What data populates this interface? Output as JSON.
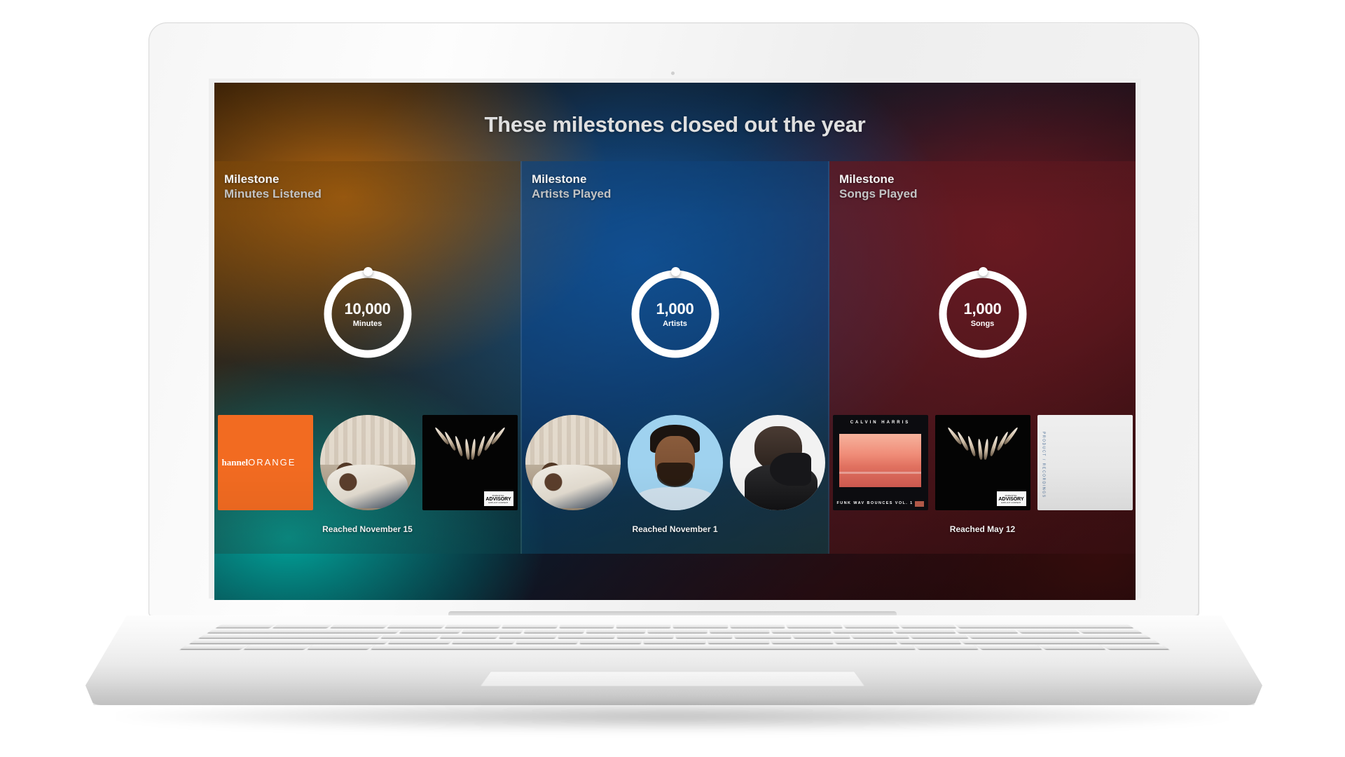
{
  "device": {
    "type": "laptop-mockup",
    "model": "silver laptop"
  },
  "screen": {
    "title": "These milestones closed out the year",
    "accent_colors": {
      "orange": "#c46e0e",
      "blue": "#1460b0",
      "maroon": "#7c1a22",
      "teal": "#00b0a6",
      "ring": "#ffffff"
    },
    "cards": [
      {
        "kicker": "Milestone",
        "name": "Minutes Listened",
        "ring": {
          "value": "10,000",
          "unit": "Minutes",
          "progress_percent": 100
        },
        "reached": "Reached November 15",
        "artwork": [
          {
            "id": "channel-orange",
            "shape": "square",
            "title_bold": "hannel",
            "title_light": "ORANGE"
          },
          {
            "id": "photo-lying",
            "shape": "circle"
          },
          {
            "id": "black-panther",
            "shape": "square",
            "advisory_top": "PARENTAL",
            "advisory_mid": "ADVISORY",
            "advisory_bottom": "EXPLICIT CONTENT"
          }
        ]
      },
      {
        "kicker": "Milestone",
        "name": "Artists Played",
        "ring": {
          "value": "1,000",
          "unit": "Artists",
          "progress_percent": 100
        },
        "reached": "Reached November 1",
        "artwork": [
          {
            "id": "photo-lying",
            "shape": "circle"
          },
          {
            "id": "frank-avatar",
            "shape": "circle"
          },
          {
            "id": "drake-avatar",
            "shape": "circle"
          }
        ]
      },
      {
        "kicker": "Milestone",
        "name": "Songs Played",
        "ring": {
          "value": "1,000",
          "unit": "Songs",
          "progress_percent": 100
        },
        "reached": "Reached May 12",
        "artwork": [
          {
            "id": "calvin-harris",
            "shape": "square",
            "artist": "CALVIN HARRIS",
            "album": "FUNK WAV BOUNCES VOL. 1"
          },
          {
            "id": "black-panther",
            "shape": "square",
            "advisory_top": "PARENTAL",
            "advisory_mid": "ADVISORY",
            "advisory_bottom": "EXPLICIT CONTENT"
          },
          {
            "id": "partial-white",
            "shape": "square",
            "spine": "PRODUCT / RECORDINGS"
          }
        ]
      }
    ]
  }
}
